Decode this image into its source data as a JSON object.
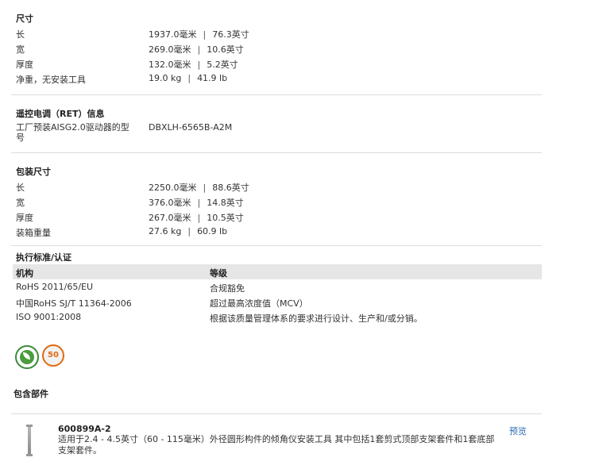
{
  "dimensions": {
    "heading": "尺寸",
    "rows": [
      {
        "label": "长",
        "metric": "1937.0毫米",
        "imperial": "76.3英寸"
      },
      {
        "label": "宽",
        "metric": "269.0毫米",
        "imperial": "10.6英寸"
      },
      {
        "label": "厚度",
        "metric": "132.0毫米",
        "imperial": "5.2英寸"
      },
      {
        "label": "净重，无安装工具",
        "metric": "19.0 kg",
        "imperial": "41.9 lb"
      }
    ]
  },
  "ret": {
    "heading": "遥控电调（RET）信息",
    "label_line1": "工厂预装AISG2.0驱动器的型",
    "label_line2": "号",
    "value": "DBXLH-6565B-A2M"
  },
  "packaging": {
    "heading": "包装尺寸",
    "rows": [
      {
        "label": "长",
        "metric": "2250.0毫米",
        "imperial": "88.6英寸"
      },
      {
        "label": "宽",
        "metric": "376.0毫米",
        "imperial": "14.8英寸"
      },
      {
        "label": "厚度",
        "metric": "267.0毫米",
        "imperial": "10.5英寸"
      },
      {
        "label": "装箱重量",
        "metric": "27.6 kg",
        "imperial": "60.9 lb"
      }
    ]
  },
  "standards": {
    "heading": "执行标准/认证",
    "col_org": "机构",
    "col_level": "等级",
    "rows": [
      {
        "org": "RoHS 2011/65/EU",
        "level": "合规豁免"
      },
      {
        "org": "中国RoHS SJ/T 11364-2006",
        "level": "超过最高浓度值（MCV）"
      },
      {
        "org": "ISO 9001:2008",
        "level": "根据该质量管理体系的要求进行设计、生产和/或分销。"
      }
    ],
    "logos": {
      "rohs_icon": "green-leaf-rohs-icon",
      "china_rohs_icon": "orange-50-year-icon",
      "china_rohs_number": "50"
    }
  },
  "separator": "|",
  "included": {
    "heading": "包含部件",
    "part_number": "600899A-2",
    "description": "适用于2.4 - 4.5英寸（60 - 115毫米）外径圆形构件的倾角仪安装工具 其中包括1套剪式顶部支架套件和1套底部支架套件。",
    "preview_label": "预览"
  },
  "colors": {
    "link": "#2a6ab5",
    "logo_green": "#4a9c3c",
    "logo_orange": "#e06a12",
    "header_bg": "#e6e6e6"
  }
}
